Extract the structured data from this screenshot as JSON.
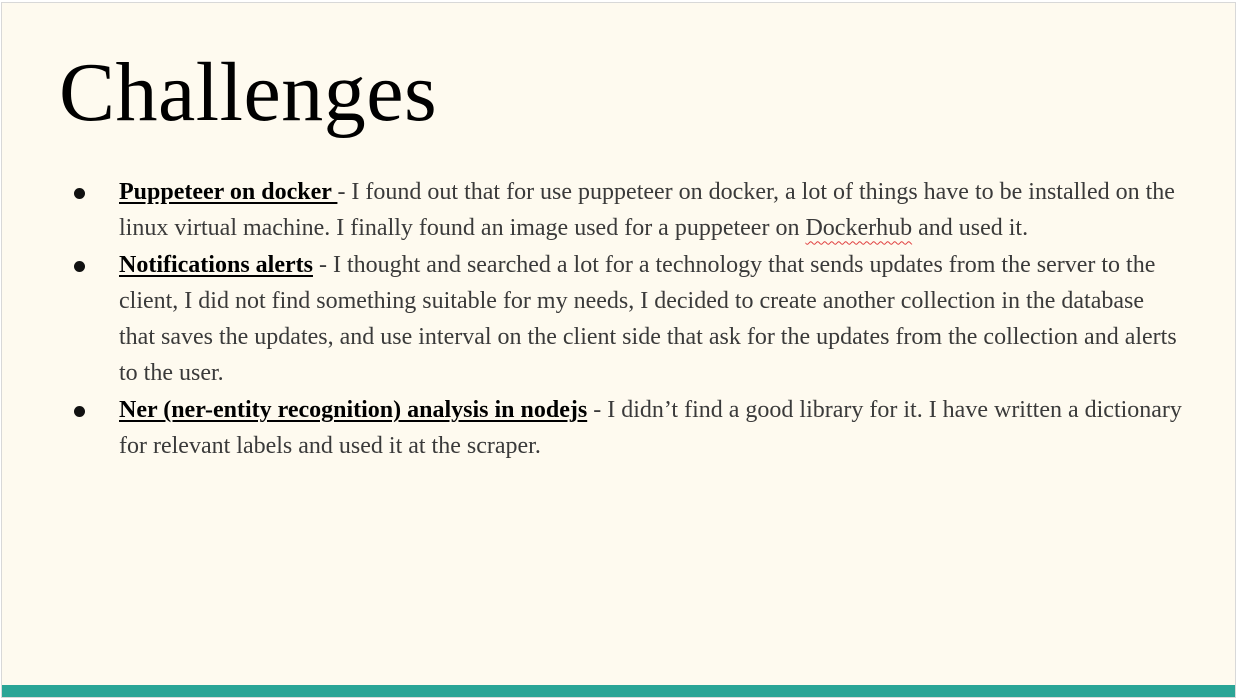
{
  "slide": {
    "title": "Challenges",
    "accent_color": "#2aa596",
    "background_color": "#fefaef",
    "bullets": [
      {
        "lead": "Puppeteer on docker ",
        "text_1": " - I found out that for use puppeteer on docker, a lot of things have to be installed on the linux virtual machine. I finally found an image used for a puppeteer on ",
        "squiggle_word": "Dockerhub",
        "text_2": " and used it."
      },
      {
        "lead": "Notifications alerts",
        "text_1": " - I thought and searched a lot for a technology that sends updates from the server to the client, I did not find something suitable for my needs, I decided to create another collection in the database that saves the updates, and use interval on the client side that ask for the updates from the collection and alerts to the user."
      },
      {
        "lead": "Ner (ner-entity recognition) analysis in nodejs",
        "text_1": " - I didn’t find a good library for it. I have written a dictionary for relevant labels and used it at the scraper."
      }
    ]
  }
}
